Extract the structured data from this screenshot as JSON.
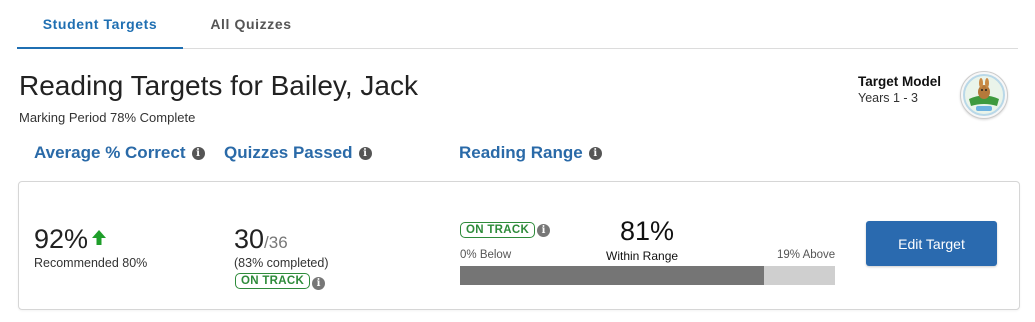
{
  "tabs": [
    {
      "label": "Student Targets",
      "active": true
    },
    {
      "label": "All Quizzes",
      "active": false
    }
  ],
  "header": {
    "title": "Reading Targets for Bailey, Jack",
    "subtitle": "Marking Period 78% Complete"
  },
  "target_model": {
    "title": "Target Model",
    "years": "Years 1 - 3"
  },
  "sections": {
    "average_correct": "Average % Correct",
    "quizzes_passed": "Quizzes Passed",
    "reading_range": "Reading Range"
  },
  "average": {
    "value": "92%",
    "trend": "up",
    "recommended": "Recommended 80%"
  },
  "quizzes": {
    "passed": "30",
    "total": "/36",
    "completed": "(83% completed)",
    "status": "ON TRACK"
  },
  "reading_range": {
    "status": "ON TRACK",
    "within_pct": "81%",
    "below_label": "0% Below",
    "within_label": "Within Range",
    "above_label": "19% Above",
    "below_fraction": 0,
    "within_fraction": 0.81,
    "above_fraction": 0.19
  },
  "actions": {
    "edit_target": "Edit Target"
  },
  "colors": {
    "accent": "#2a6aa8",
    "on_track": "#2e8b3a",
    "up_arrow": "#1e9e2a",
    "bar_fill": "#757575",
    "bar_track": "#cfcfcf"
  }
}
